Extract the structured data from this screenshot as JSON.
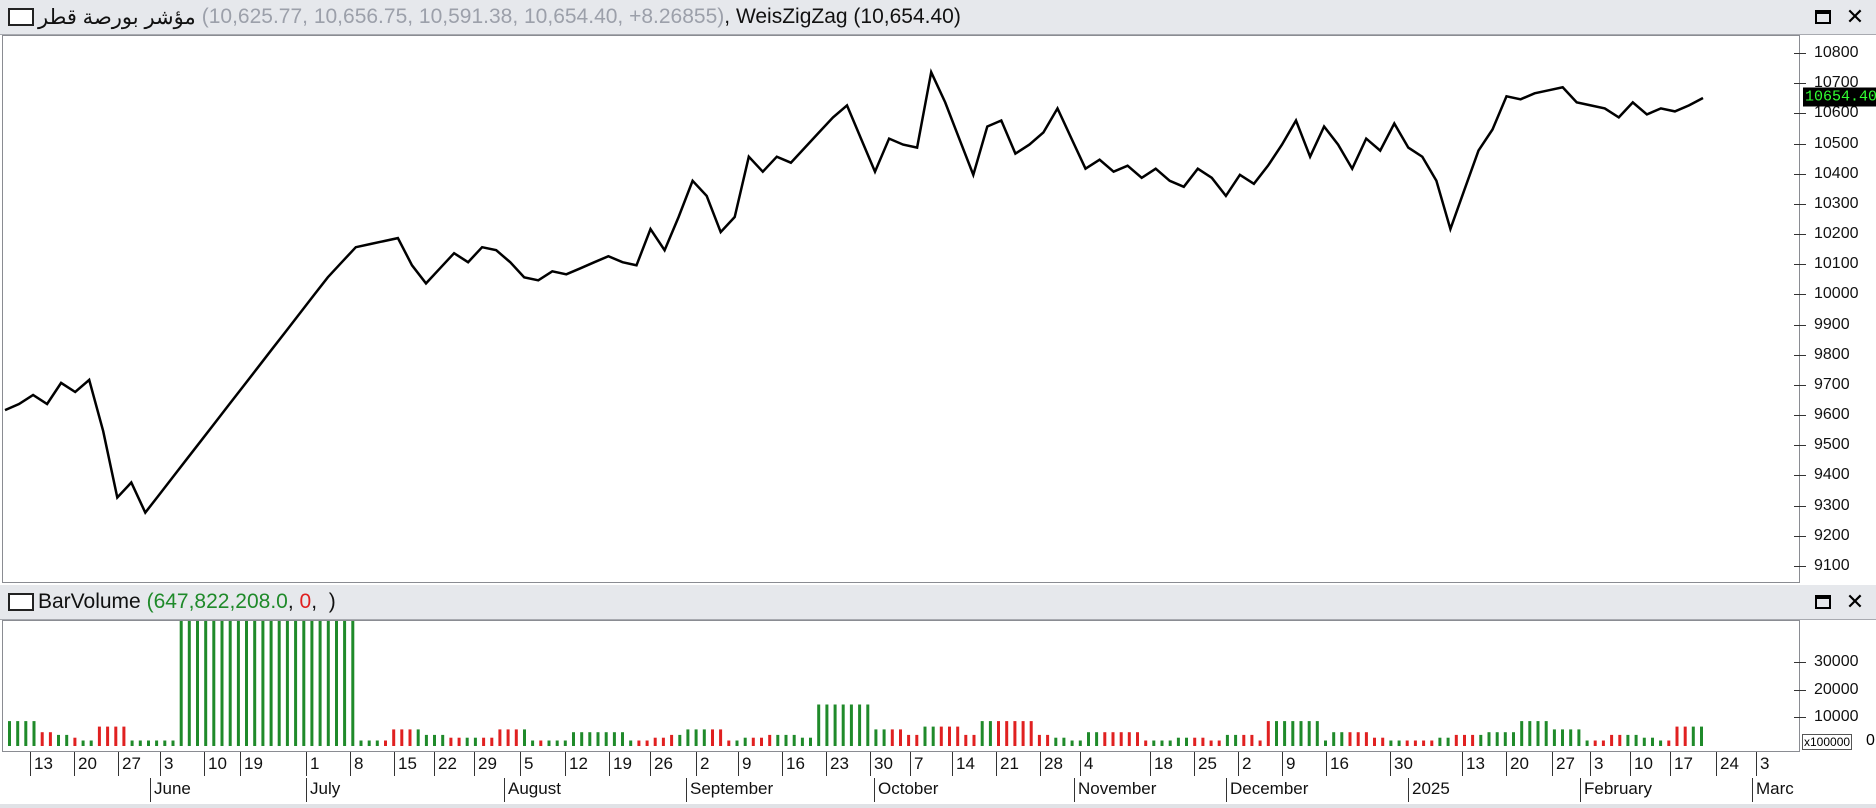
{
  "price_pane": {
    "title_symbol": "مؤشر بورصة قطر",
    "title_values": "(10,625.77, 10,656.75, 10,591.38, 10,654.40, +8.26855)",
    "indicator": "WeisZigZag (10,654.40)",
    "last_price_label": "10654.40"
  },
  "volume_pane": {
    "title_name": "BarVolume",
    "value_green": "647,822,208.0",
    "value_red": "0",
    "multiplier_label": "x100000",
    "multiplier_zero": "0"
  },
  "window_buttons": {
    "maximize_icon": "maximize-icon",
    "close_icon": "close-icon",
    "close_glyph": "✕"
  },
  "colors": {
    "up": "#1f8a2a",
    "down": "#e02020",
    "line": "#000000",
    "price_bg": "#000000",
    "price_fg": "#32ff32"
  },
  "chart_data": [
    {
      "type": "line",
      "series": [
        {
          "values": [
            9620,
            9640,
            9670,
            9640,
            9710,
            9680,
            9720,
            9550,
            9330,
            9380,
            9280,
            9340,
            9400,
            9460,
            9520,
            9580,
            9640,
            9700,
            9760,
            9820,
            9880,
            9940,
            10000,
            10060,
            10110,
            10160,
            10170,
            10180,
            10190,
            10100,
            10040,
            10090,
            10140,
            10110,
            10160,
            10150,
            10110,
            10060,
            10050,
            10080,
            10070,
            10090,
            10110,
            10130,
            10110,
            10100,
            10220,
            10150,
            10260,
            10380,
            10330,
            10210,
            10260,
            10460,
            10410,
            10460,
            10440,
            10490,
            10540,
            10590,
            10630,
            10520,
            10410,
            10520,
            10500,
            10490,
            10740,
            10640,
            10520,
            10400,
            10560,
            10580,
            10470,
            10500,
            10540,
            10620,
            10520,
            10420,
            10450,
            10410,
            10430,
            10390,
            10420,
            10380,
            10360,
            10420,
            10390,
            10330,
            10400,
            10370,
            10430,
            10500,
            10580,
            10460,
            10560,
            10500,
            10420,
            10520,
            10480,
            10570,
            10490,
            10460,
            10380,
            10220,
            10350,
            10480,
            10550,
            10660,
            10650,
            10670,
            10680,
            10690,
            10640,
            10630,
            10620,
            10590,
            10640,
            10600,
            10620,
            10610,
            10630,
            10654.4
          ]
        }
      ],
      "ylim": [
        9050,
        10860
      ],
      "yticks": [
        "9100",
        "9200",
        "9300",
        "9400",
        "9500",
        "9600",
        "9700",
        "9800",
        "9900",
        "10000",
        "10100",
        "10200",
        "10300",
        "10400",
        "10500",
        "10600",
        "10700",
        "10800"
      ]
    },
    {
      "type": "bar",
      "series": [
        {
          "values": [
            9,
            9,
            9,
            9,
            5,
            5,
            4,
            4,
            3,
            2,
            2,
            7,
            7,
            7,
            7,
            2,
            2,
            2,
            2,
            2,
            2,
            50,
            50,
            50,
            50,
            50,
            50,
            50,
            50,
            50,
            50,
            50,
            50,
            50,
            50,
            50,
            50,
            50,
            50,
            50,
            50,
            50,
            50,
            2,
            2,
            2,
            2,
            6,
            6,
            6,
            6,
            4,
            4,
            4,
            3,
            3,
            3,
            3,
            3,
            3,
            6,
            6,
            6,
            6,
            2,
            2,
            2,
            2,
            2,
            5,
            5,
            5,
            5,
            5,
            5,
            5,
            2,
            2,
            2,
            3,
            3,
            4,
            4,
            6,
            6,
            6,
            6,
            6,
            2,
            2,
            3,
            3,
            3,
            4,
            4,
            4,
            4,
            3,
            3,
            15,
            15,
            15,
            15,
            15,
            15,
            15,
            6,
            6,
            6,
            6,
            4,
            4,
            7,
            7,
            7,
            7,
            7,
            4,
            4,
            9,
            9,
            9,
            9,
            9,
            9,
            9,
            4,
            4,
            3,
            3,
            2,
            2,
            5,
            5,
            5,
            5,
            5,
            5,
            5,
            2,
            2,
            2,
            2,
            3,
            3,
            3,
            3,
            2,
            2,
            4,
            4,
            4,
            4,
            2,
            9,
            9,
            9,
            9,
            9,
            9,
            9,
            2,
            5,
            5,
            5,
            5,
            5,
            3,
            3,
            2,
            2,
            2,
            2,
            2,
            2,
            3,
            3,
            4,
            4,
            4,
            4,
            5,
            5,
            5,
            5,
            9,
            9,
            9,
            9,
            6,
            6,
            6,
            6,
            2,
            2,
            2,
            4,
            4,
            4,
            4,
            3,
            3,
            2,
            2,
            7,
            7,
            7,
            7
          ]
        }
      ],
      "colors": [
        "up",
        "up",
        "up",
        "up",
        "down",
        "down",
        "up",
        "up",
        "down",
        "up",
        "up",
        "down",
        "down",
        "down",
        "down",
        "up",
        "up",
        "up",
        "up",
        "up",
        "up",
        "up",
        "up",
        "up",
        "up",
        "up",
        "up",
        "up",
        "up",
        "up",
        "up",
        "up",
        "up",
        "up",
        "up",
        "up",
        "up",
        "up",
        "up",
        "up",
        "up",
        "up",
        "up",
        "up",
        "up",
        "up",
        "down",
        "down",
        "down",
        "down",
        "up",
        "up",
        "up",
        "up",
        "down",
        "down",
        "up",
        "up",
        "down",
        "down",
        "down",
        "down",
        "down",
        "up",
        "up",
        "down",
        "up",
        "up",
        "up",
        "up",
        "up",
        "up",
        "up",
        "up",
        "up",
        "up",
        "up",
        "down",
        "down",
        "down",
        "down",
        "down",
        "up",
        "up",
        "up",
        "up",
        "down",
        "down",
        "down",
        "up",
        "up",
        "down",
        "down",
        "down",
        "up",
        "up",
        "up",
        "up",
        "up",
        "up",
        "up",
        "up",
        "up",
        "up",
        "up",
        "up",
        "up",
        "up",
        "down",
        "down",
        "down",
        "down",
        "up",
        "up",
        "down",
        "down",
        "down",
        "down",
        "down",
        "up",
        "up",
        "down",
        "down",
        "down",
        "down",
        "down",
        "down",
        "down",
        "up",
        "up",
        "up",
        "up",
        "up",
        "up",
        "down",
        "down",
        "down",
        "down",
        "down",
        "down",
        "up",
        "up",
        "up",
        "up",
        "up",
        "down",
        "down",
        "down",
        "down",
        "up",
        "up",
        "down",
        "down",
        "down",
        "down",
        "up",
        "up",
        "up",
        "up",
        "up",
        "up",
        "up",
        "up",
        "up",
        "down",
        "down",
        "down",
        "down",
        "down",
        "up",
        "up",
        "down",
        "down",
        "down",
        "down",
        "up",
        "up",
        "down",
        "down",
        "down",
        "up",
        "up",
        "up",
        "up",
        "up",
        "up",
        "up",
        "up",
        "up",
        "up",
        "up",
        "up",
        "up",
        "up",
        "down",
        "down",
        "down",
        "down",
        "up",
        "up",
        "up",
        "up",
        "up",
        "down",
        "down",
        "down",
        "up",
        "up",
        "up",
        "up",
        "up",
        "up"
      ],
      "ylim": [
        0,
        43000
      ],
      "yticks": [
        "10000",
        "20000",
        "30000"
      ]
    }
  ],
  "x_axis": {
    "days": [
      "13",
      "20",
      "27",
      "3",
      "10",
      "19",
      "1",
      "8",
      "15",
      "22",
      "29",
      "5",
      "12",
      "19",
      "26",
      "2",
      "9",
      "16",
      "23",
      "30",
      "7",
      "14",
      "21",
      "28",
      "4",
      "18",
      "25",
      "2",
      "9",
      "16",
      "30",
      "13",
      "20",
      "27",
      "3",
      "10",
      "17",
      "24",
      "3"
    ],
    "months": [
      "June",
      "July",
      "August",
      "September",
      "October",
      "November",
      "December",
      "2025",
      "February",
      "Marc"
    ]
  }
}
